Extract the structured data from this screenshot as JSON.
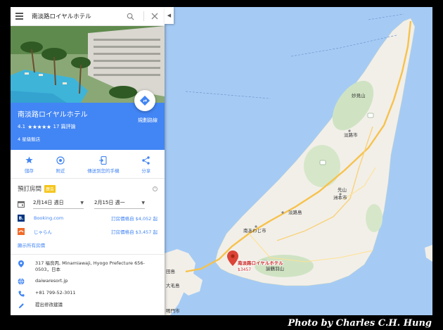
{
  "search": {
    "query": "南淡路ロイヤルホテル"
  },
  "place": {
    "name": "南淡路ロイヤルホテル",
    "rating": "4.1",
    "stars": "★★★★★",
    "reviews": "17 篇評論",
    "hotel_class": "4 星級飯店",
    "directions_label": "規劃路線"
  },
  "actions": [
    {
      "label": "儲存"
    },
    {
      "label": "附近"
    },
    {
      "label": "傳送到您的手機"
    },
    {
      "label": "分享"
    }
  ],
  "booking": {
    "heading": "預訂房間",
    "ad_badge": "廣告",
    "checkin": "2月14日 週日",
    "checkout": "2月15日 週一",
    "providers": [
      {
        "name": "Booking.com",
        "price_text": "訂房價格自 $4,052 起",
        "logo_letter": "B.",
        "logo_color": "#003580"
      },
      {
        "name": "じゃらん",
        "price_text": "訂房價格自 $3,457 起",
        "logo_letter": "",
        "logo_color": "#ef6c2b"
      }
    ],
    "show_all": "顯示所有房價"
  },
  "details": {
    "address": "317 福良丙, Minamiawaji, Hyogo Prefecture 656-0503，日本",
    "website": "daiwaresort.jp",
    "phone": "+81 799-52-3011",
    "suggest_edit": "提出修改建議"
  },
  "map": {
    "marker_title": "南淡路ロイヤルホテル",
    "marker_price": "$3457",
    "labels": {
      "awaji_city": "淡路市",
      "sumoto_city": "洲本市",
      "awaji_island": "淡路島",
      "minami_awaji_city": "南あわじ市",
      "myokenyama": "妙見山",
      "senzan": "先山",
      "yuzuruha": "諭鶴羽山",
      "ohge": "大毛島",
      "naruto": "鳴門市",
      "tian": "田島"
    },
    "colors": {
      "land": "#f2efe9",
      "water": "#a5cbf5",
      "road": "#f7c24b"
    }
  },
  "watermark": "Photo by Charles C.H. Hung"
}
